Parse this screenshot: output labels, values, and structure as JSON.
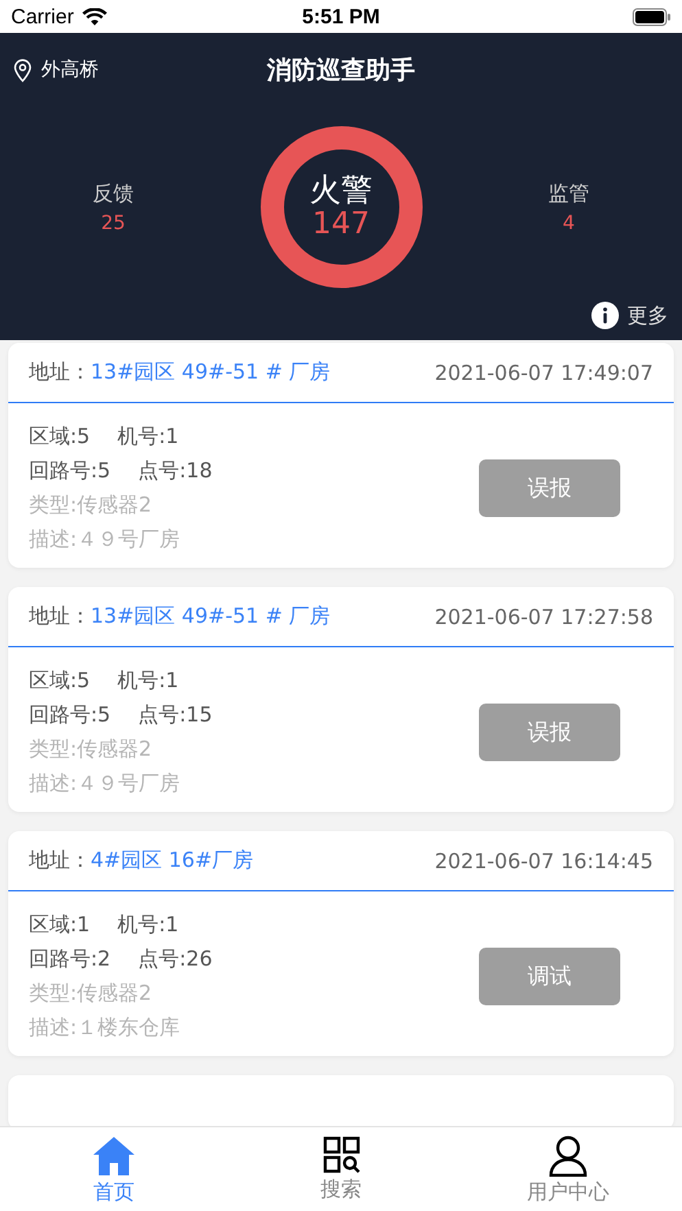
{
  "status_bar": {
    "carrier": "Carrier",
    "time": "5:51 PM"
  },
  "header": {
    "location": "外高桥",
    "title": "消防巡查助手",
    "center": {
      "label": "火警",
      "count": "147"
    },
    "stats": [
      {
        "label": "反馈",
        "count": "25"
      },
      {
        "label": "监管",
        "count": "4"
      }
    ],
    "more": "更多"
  },
  "alarms": [
    {
      "address_label": "地址：",
      "address": "13#园区 49#-51 # 厂房",
      "time": "2021-06-07 17:49:07",
      "zone": "区域:5",
      "machine": "机号:1",
      "loop": "回路号:5",
      "point": "点号:18",
      "type": "类型:传感器2",
      "description": "描述:４９号厂房",
      "action": "误报"
    },
    {
      "address_label": "地址：",
      "address": "13#园区 49#-51 # 厂房",
      "time": "2021-06-07 17:27:58",
      "zone": "区域:5",
      "machine": "机号:1",
      "loop": "回路号:5",
      "point": "点号:15",
      "type": "类型:传感器2",
      "description": "描述:４９号厂房",
      "action": "误报"
    },
    {
      "address_label": "地址：",
      "address": "4#园区 16#厂房",
      "time": "2021-06-07 16:14:45",
      "zone": "区域:1",
      "machine": "机号:1",
      "loop": "回路号:2",
      "point": "点号:26",
      "type": "类型:传感器2",
      "description": "描述:１楼东仓库",
      "action": "调试"
    }
  ],
  "tabs": [
    {
      "label": "首页",
      "kind": "home",
      "selected": true
    },
    {
      "label": "搜索",
      "kind": "search",
      "selected": false
    },
    {
      "label": "用户中心",
      "kind": "user",
      "selected": false
    }
  ]
}
